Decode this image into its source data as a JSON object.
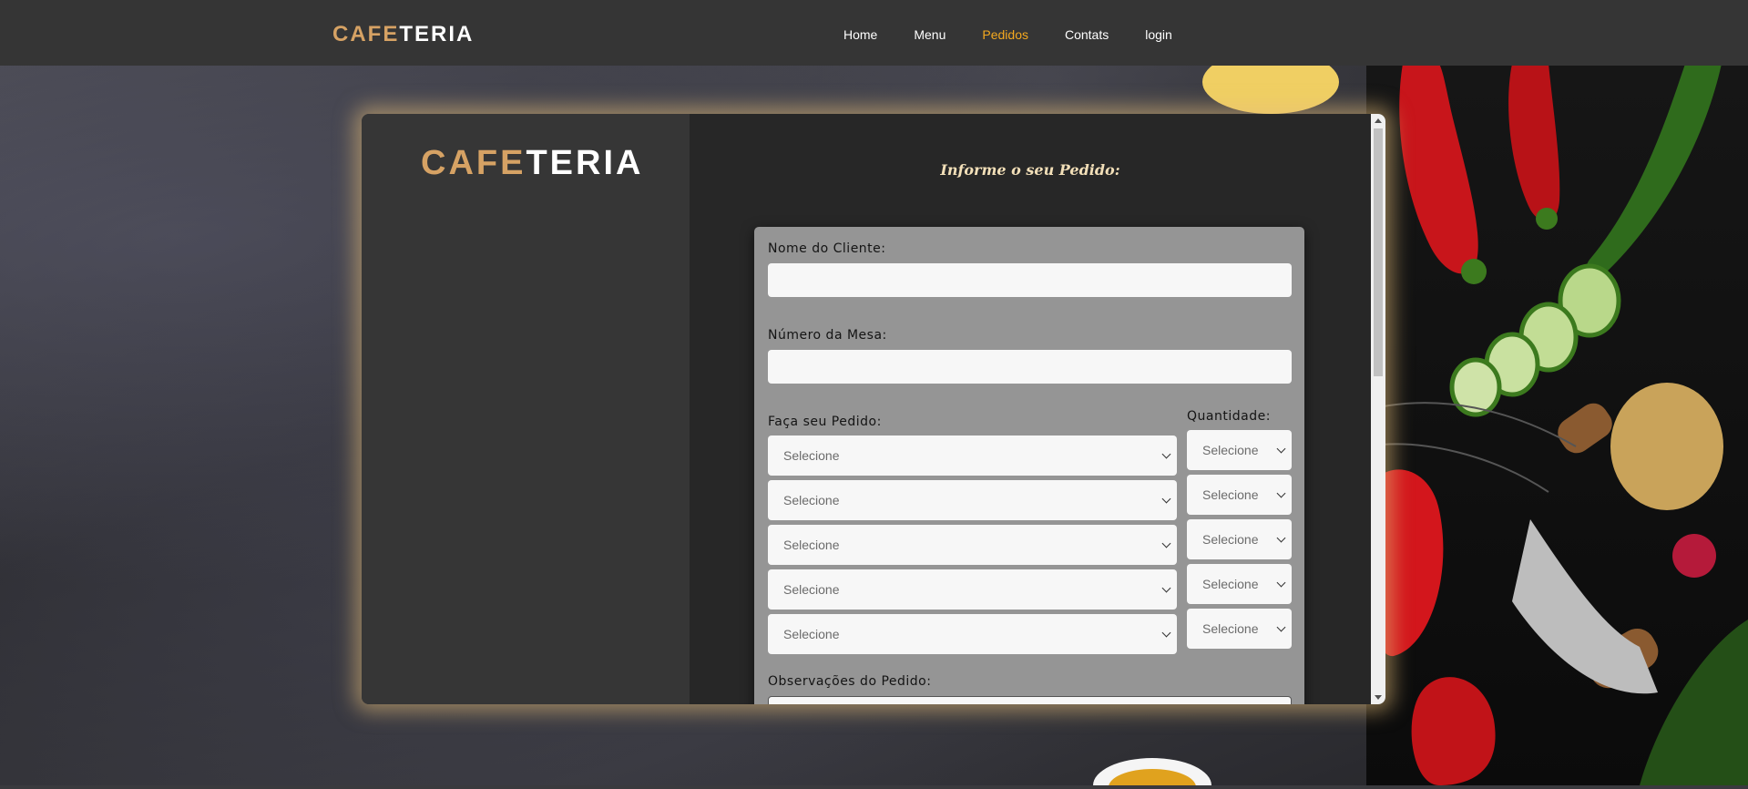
{
  "brand": {
    "part1": "CAFE",
    "part2": "TERIA"
  },
  "nav": {
    "items": [
      {
        "label": "Home"
      },
      {
        "label": "Menu"
      },
      {
        "label": "Pedidos"
      },
      {
        "label": "Contats"
      },
      {
        "label": "login"
      }
    ],
    "active": "Pedidos"
  },
  "colors": {
    "accent": "#f4a91f",
    "brand_gold": "#d6a264",
    "glow": "#e6be78"
  },
  "form": {
    "title": "Informe o seu Pedido:",
    "client_name_label": "Nome do Cliente:",
    "client_name_value": "",
    "table_number_label": "Número da Mesa:",
    "table_number_value": "",
    "order_label": "Faça seu Pedido:",
    "quantity_label": "Quantidade:",
    "order_selects": [
      "Selecione",
      "Selecione",
      "Selecione",
      "Selecione",
      "Selecione"
    ],
    "quantity_selects": [
      "Selecione",
      "Selecione",
      "Selecione",
      "Selecione",
      "Selecione"
    ],
    "notes_label": "Observações do Pedido:",
    "notes_value": ""
  }
}
